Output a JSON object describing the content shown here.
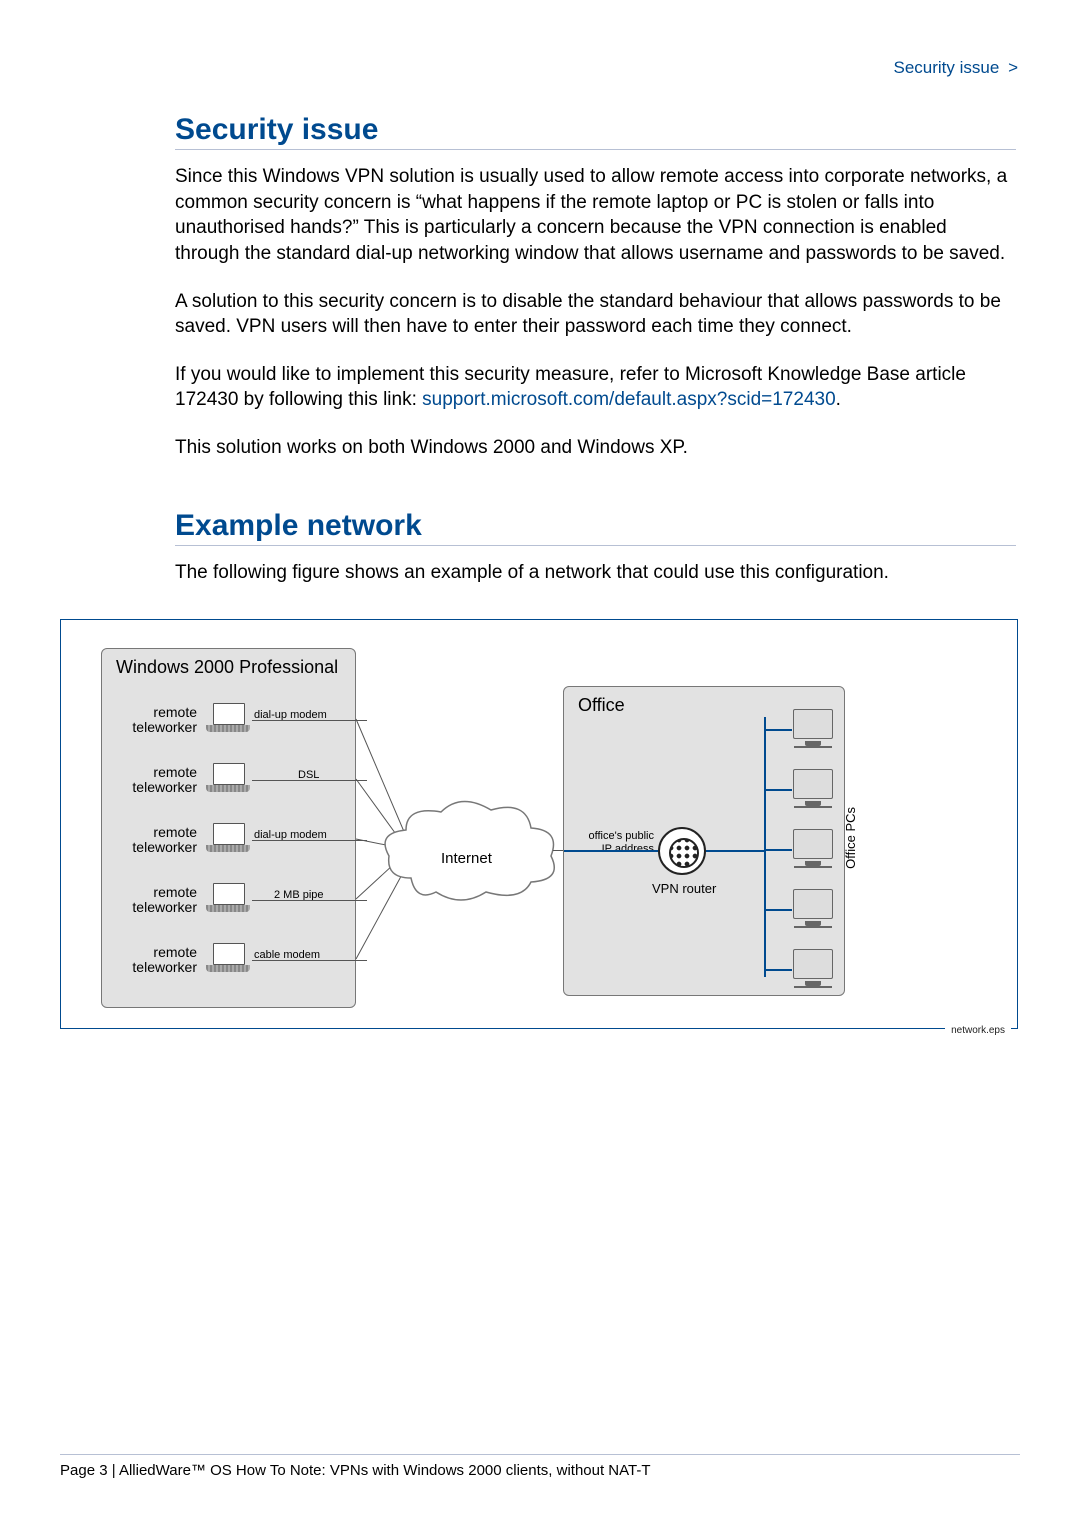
{
  "header": {
    "breadcrumb": "Security issue",
    "chevron": ">"
  },
  "sections": {
    "security": {
      "title": "Security issue",
      "p1": "Since this Windows VPN solution is usually used to allow remote access into corporate networks, a common security concern is “what happens if the remote laptop or PC is stolen or falls into unauthorised hands?” This is particularly a concern because the VPN connection is enabled through the standard dial-up networking window that allows username and passwords to be saved.",
      "p2": "A solution to this security concern is to disable the standard behaviour that allows passwords to be saved. VPN users will then have to enter their password each time they connect.",
      "p3a": "If you would like to implement this security measure, refer to Microsoft Knowledge Base article 172430 by following this link: ",
      "p3_link": "support.microsoft.com/default.aspx?scid=172430",
      "p3b": ".",
      "p4": "This solution works on both Windows 2000 and Windows XP."
    },
    "example": {
      "title": "Example network",
      "p1": "The following figure shows an example of a network that could use this configuration."
    }
  },
  "diagram": {
    "win_title": "Windows 2000 Professional",
    "teleworkers": [
      {
        "label": "remote\nteleworker",
        "conn": "dial-up modem"
      },
      {
        "label": "remote\nteleworker",
        "conn": "DSL"
      },
      {
        "label": "remote\nteleworker",
        "conn": "dial-up modem"
      },
      {
        "label": "remote\nteleworker",
        "conn": "2 MB pipe"
      },
      {
        "label": "remote\nteleworker",
        "conn": "cable modem"
      }
    ],
    "cloud": "Internet",
    "office_title": "Office",
    "public_ip": "office's public\nIP address",
    "vpn_router": "VPN router",
    "office_pcs": "Office PCs",
    "eps": "network.eps"
  },
  "footer": "Page 3 | AlliedWare™ OS How To Note: VPNs with Windows 2000 clients, without NAT-T"
}
